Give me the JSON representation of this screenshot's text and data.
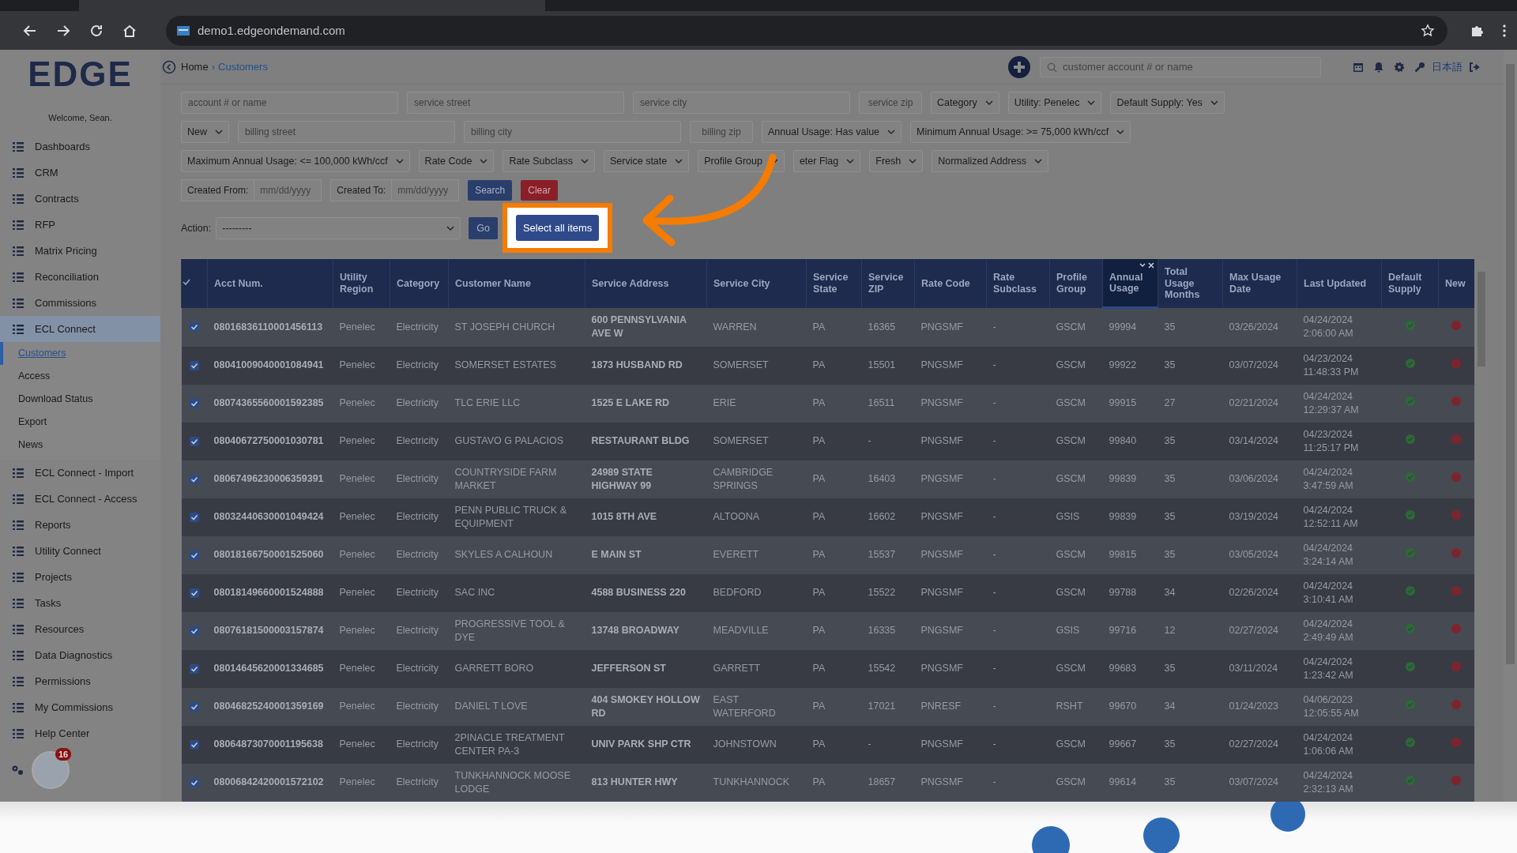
{
  "browser": {
    "url": "demo1.edgeondemand.com"
  },
  "sidebar": {
    "logo": "EDGE",
    "welcome": "Welcome, Sean.",
    "badge": "16",
    "items": [
      {
        "label": "Dashboards",
        "selected": false
      },
      {
        "label": "CRM",
        "selected": false
      },
      {
        "label": "Contracts",
        "selected": false
      },
      {
        "label": "RFP",
        "selected": false
      },
      {
        "label": "Matrix Pricing",
        "selected": false
      },
      {
        "label": "Reconciliation",
        "selected": false
      },
      {
        "label": "Commissions",
        "selected": false
      },
      {
        "label": "ECL Connect",
        "selected": true,
        "children": [
          {
            "label": "Customers",
            "selected": true
          },
          {
            "label": "Access",
            "selected": false
          },
          {
            "label": "Download Status",
            "selected": false
          },
          {
            "label": "Export",
            "selected": false
          },
          {
            "label": "News",
            "selected": false
          }
        ]
      },
      {
        "label": "ECL Connect - Import",
        "selected": false
      },
      {
        "label": "ECL Connect - Access",
        "selected": false
      },
      {
        "label": "Reports",
        "selected": false
      },
      {
        "label": "Utility Connect",
        "selected": false
      },
      {
        "label": "Projects",
        "selected": false
      },
      {
        "label": "Tasks",
        "selected": false
      },
      {
        "label": "Resources",
        "selected": false
      },
      {
        "label": "Data Diagnostics",
        "selected": false
      },
      {
        "label": "Permissions",
        "selected": false
      },
      {
        "label": "My Commissions",
        "selected": false
      },
      {
        "label": "Help Center",
        "selected": false
      }
    ]
  },
  "header": {
    "breadcrumb": [
      "Home",
      "›",
      "Customers"
    ],
    "search": {
      "placeholder": "customer account # or name"
    },
    "language": "日本語"
  },
  "filters": [
    [
      {
        "kind": "text",
        "placeholder": "account # or name"
      },
      {
        "kind": "text",
        "placeholder": "service street"
      },
      {
        "kind": "text",
        "placeholder": "service city"
      },
      {
        "kind": "short",
        "placeholder": "service zip"
      },
      {
        "kind": "select",
        "value": "Category"
      },
      {
        "kind": "select",
        "value": "Utility: Penelec"
      },
      {
        "kind": "select",
        "value": "Default Supply: Yes"
      }
    ],
    [
      {
        "kind": "select",
        "value": "New"
      },
      {
        "kind": "text",
        "placeholder": "billing street"
      },
      {
        "kind": "text",
        "placeholder": "billing city"
      },
      {
        "kind": "short",
        "placeholder": "billing zip"
      },
      {
        "kind": "select",
        "value": "Annual Usage: Has value"
      },
      {
        "kind": "select",
        "value": "Minimum Annual Usage: >= 75,000 kWh/ccf"
      }
    ],
    [
      {
        "kind": "select",
        "value": "Maximum Annual Usage: <= 100,000 kWh/ccf"
      },
      {
        "kind": "select",
        "value": "Rate Code"
      },
      {
        "kind": "select",
        "value": "Rate Subclass"
      },
      {
        "kind": "select",
        "value": "Service state"
      },
      {
        "kind": "select",
        "value": "Profile Group"
      },
      {
        "kind": "select",
        "value": "eter Flag"
      },
      {
        "kind": "select",
        "value": "Fresh"
      },
      {
        "kind": "select",
        "value": "Normalized Address"
      }
    ],
    [
      {
        "kind": "date",
        "label": "Created From:",
        "placeholder": "mm/dd/yyyy"
      },
      {
        "kind": "date",
        "label": "Created To:",
        "placeholder": "mm/dd/yyyy"
      },
      {
        "kind": "primary",
        "label": "Search"
      },
      {
        "kind": "danger",
        "label": "Clear"
      }
    ]
  ],
  "action": {
    "label": "Action:",
    "value": "---------",
    "go": "Go",
    "select_all": "Select all items"
  },
  "table": {
    "all_checked": true,
    "columns": [
      {
        "label": "Acct Num.",
        "sorted": false
      },
      {
        "label": "Utility Region",
        "sorted": false
      },
      {
        "label": "Category",
        "sorted": false
      },
      {
        "label": "Customer Name",
        "sorted": false
      },
      {
        "label": "Service Address",
        "sorted": false
      },
      {
        "label": "Service City",
        "sorted": false
      },
      {
        "label": "Service State",
        "sorted": false
      },
      {
        "label": "Service ZIP",
        "sorted": false
      },
      {
        "label": "Rate Code",
        "sorted": false
      },
      {
        "label": "Rate Subclass",
        "sorted": false
      },
      {
        "label": "Profile Group",
        "sorted": false
      },
      {
        "label": "Annual Usage",
        "sorted": true
      },
      {
        "label": "Total Usage Months",
        "sorted": false
      },
      {
        "label": "Max Usage Date",
        "sorted": false
      },
      {
        "label": "Last Updated",
        "sorted": false
      },
      {
        "label": "Default Supply",
        "sorted": false
      },
      {
        "label": "New",
        "sorted": false
      }
    ],
    "rows": [
      {
        "checked": true,
        "cells": [
          "08016836110001456113",
          "Penelec",
          "Electricity",
          "ST JOSEPH CHURCH",
          "600 PENNSYLVANIA AVE W",
          "WARREN",
          "PA",
          "16365",
          "PNGSMF",
          "-",
          "GSCM",
          "99994",
          "35",
          "03/26/2024",
          "04/24/2024 2:06:00 AM"
        ],
        "default_supply": true,
        "new": false
      },
      {
        "checked": true,
        "cells": [
          "08041009040001084941",
          "Penelec",
          "Electricity",
          "SOMERSET ESTATES",
          "1873 HUSBAND RD",
          "SOMERSET",
          "PA",
          "15501",
          "PNGSMF",
          "-",
          "GSCM",
          "99922",
          "35",
          "03/07/2024",
          "04/23/2024 11:48:33 PM"
        ],
        "default_supply": true,
        "new": false
      },
      {
        "checked": true,
        "cells": [
          "08074365560001592385",
          "Penelec",
          "Electricity",
          "TLC ERIE LLC",
          "1525 E LAKE RD",
          "ERIE",
          "PA",
          "16511",
          "PNGSMF",
          "-",
          "GSCM",
          "99915",
          "27",
          "02/21/2024",
          "04/24/2024 12:29:37 AM"
        ],
        "default_supply": true,
        "new": false
      },
      {
        "checked": true,
        "cells": [
          "08040672750001030781",
          "Penelec",
          "Electricity",
          "GUSTAVO G PALACIOS",
          "RESTAURANT BLDG",
          "SOMERSET",
          "PA",
          "-",
          "PNGSMF",
          "-",
          "GSCM",
          "99840",
          "35",
          "03/14/2024",
          "04/23/2024 11:25:17 PM"
        ],
        "default_supply": true,
        "new": false
      },
      {
        "checked": true,
        "cells": [
          "08067496230006359391",
          "Penelec",
          "Electricity",
          "COUNTRYSIDE FARM MARKET",
          "24989 STATE HIGHWAY 99",
          "CAMBRIDGE SPRINGS",
          "PA",
          "16403",
          "PNGSMF",
          "-",
          "GSCM",
          "99839",
          "35",
          "03/06/2024",
          "04/24/2024 3:47:59 AM"
        ],
        "default_supply": true,
        "new": false
      },
      {
        "checked": true,
        "cells": [
          "08032440630001049424",
          "Penelec",
          "Electricity",
          "PENN PUBLIC TRUCK & EQUIPMENT",
          "1015 8TH AVE",
          "ALTOONA",
          "PA",
          "16602",
          "PNGSMF",
          "-",
          "GSIS",
          "99839",
          "35",
          "03/19/2024",
          "04/24/2024 12:52:11 AM"
        ],
        "default_supply": true,
        "new": false
      },
      {
        "checked": true,
        "cells": [
          "08018166750001525060",
          "Penelec",
          "Electricity",
          "SKYLES A CALHOUN",
          "E MAIN ST",
          "EVERETT",
          "PA",
          "15537",
          "PNGSMF",
          "-",
          "GSCM",
          "99815",
          "35",
          "03/05/2024",
          "04/24/2024 3:24:14 AM"
        ],
        "default_supply": true,
        "new": false
      },
      {
        "checked": true,
        "cells": [
          "08018149660001524888",
          "Penelec",
          "Electricity",
          "SAC INC",
          "4588 BUSINESS 220",
          "BEDFORD",
          "PA",
          "15522",
          "PNGSMF",
          "-",
          "GSCM",
          "99788",
          "34",
          "02/26/2024",
          "04/24/2024 3:10:41 AM"
        ],
        "default_supply": true,
        "new": false
      },
      {
        "checked": true,
        "cells": [
          "08076181500003157874",
          "Penelec",
          "Electricity",
          "PROGRESSIVE TOOL & DYE",
          "13748 BROADWAY",
          "MEADVILLE",
          "PA",
          "16335",
          "PNGSMF",
          "-",
          "GSIS",
          "99716",
          "12",
          "02/27/2024",
          "04/24/2024 2:49:49 AM"
        ],
        "default_supply": true,
        "new": false
      },
      {
        "checked": true,
        "cells": [
          "08014645620001334685",
          "Penelec",
          "Electricity",
          "GARRETT BORO",
          "JEFFERSON ST",
          "GARRETT",
          "PA",
          "15542",
          "PNGSMF",
          "-",
          "GSCM",
          "99683",
          "35",
          "03/11/2024",
          "04/24/2024 1:23:42 AM"
        ],
        "default_supply": true,
        "new": false
      },
      {
        "checked": true,
        "cells": [
          "08046825240001359169",
          "Penelec",
          "Electricity",
          "DANIEL T LOVE",
          "404 SMOKEY HOLLOW RD",
          "EAST WATERFORD",
          "PA",
          "17021",
          "PNRESF",
          "-",
          "RSHT",
          "99670",
          "34",
          "01/24/2023",
          "04/06/2023 12:05:55 AM"
        ],
        "default_supply": true,
        "new": false
      },
      {
        "checked": true,
        "cells": [
          "08064873070001195638",
          "Penelec",
          "Electricity",
          "2PINACLE TREATMENT CENTER PA-3",
          "UNIV PARK SHP CTR",
          "JOHNSTOWN",
          "PA",
          "-",
          "PNGSMF",
          "-",
          "GSCM",
          "99667",
          "35",
          "02/27/2024",
          "04/24/2024 1:06:06 AM"
        ],
        "default_supply": true,
        "new": false
      },
      {
        "checked": true,
        "cells": [
          "08006842420001572102",
          "Penelec",
          "Electricity",
          "TUNKHANNOCK MOOSE LODGE",
          "813 HUNTER HWY",
          "TUNKHANNOCK",
          "PA",
          "18657",
          "PNGSMF",
          "-",
          "GSCM",
          "99614",
          "35",
          "03/07/2024",
          "04/24/2024 2:32:13 AM"
        ],
        "default_supply": true,
        "new": false
      }
    ]
  }
}
